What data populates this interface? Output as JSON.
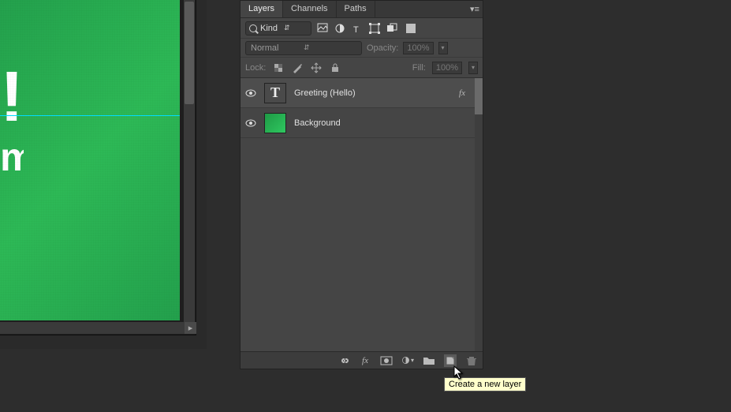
{
  "canvas": {
    "partial_text_top": "!",
    "partial_text_bottom": "m"
  },
  "tabs": {
    "layers": "Layers",
    "channels": "Channels",
    "paths": "Paths"
  },
  "filter": {
    "kind_label": "Kind"
  },
  "blend": {
    "mode": "Normal",
    "opacity_label": "Opacity:",
    "opacity_value": "100%"
  },
  "lock": {
    "label": "Lock:",
    "fill_label": "Fill:",
    "fill_value": "100%"
  },
  "layers": [
    {
      "name": "Greeting (Hello)",
      "type": "text",
      "has_fx": true
    },
    {
      "name": "Background",
      "type": "bg",
      "has_fx": false
    }
  ],
  "footer": {
    "fx": "fx"
  },
  "tooltip": "Create a new layer"
}
